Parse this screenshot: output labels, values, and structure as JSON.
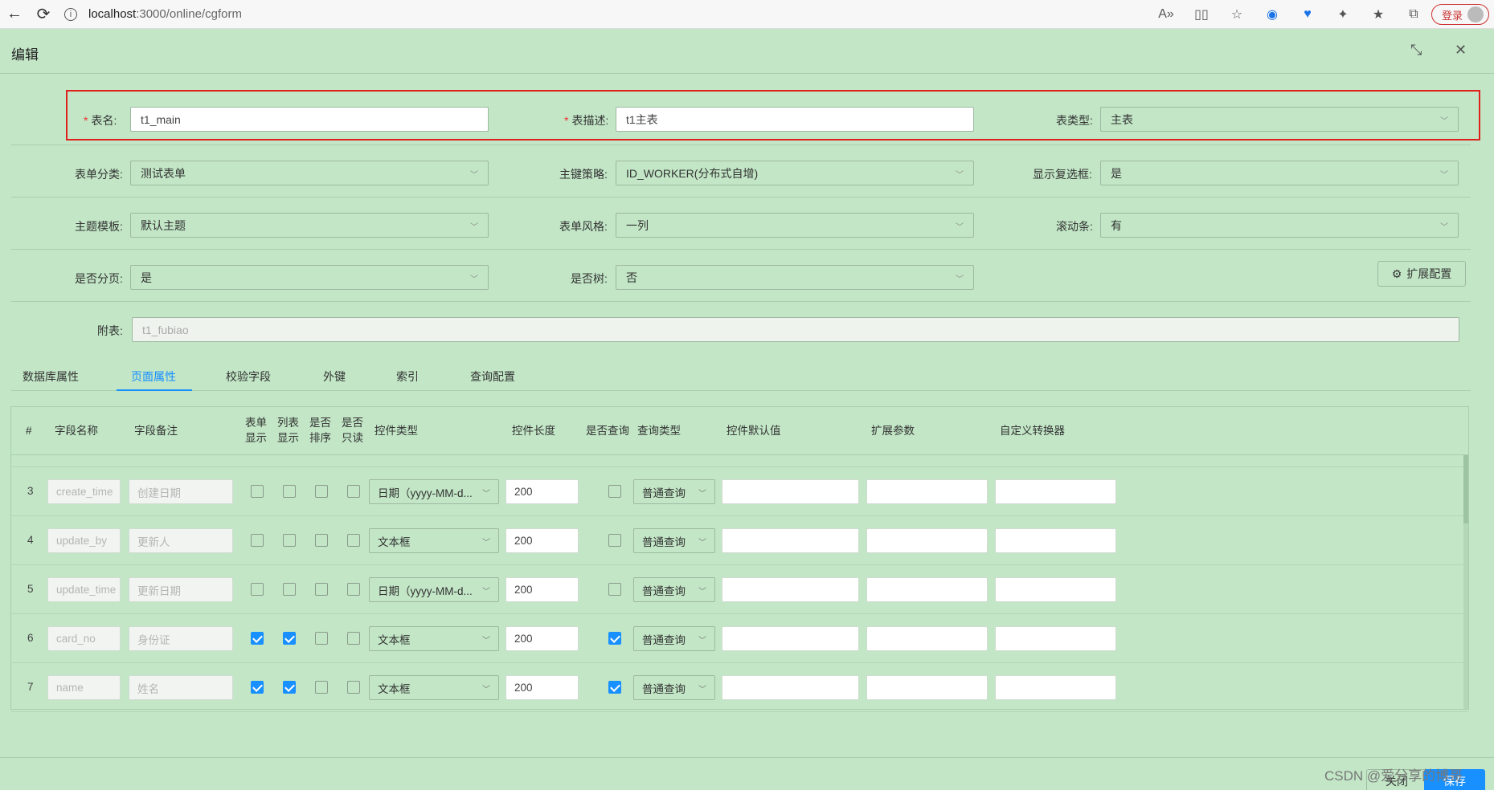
{
  "browser": {
    "url_host": "localhost",
    "url_rest": ":3000/online/cgform",
    "login_label": "登录"
  },
  "modal": {
    "title": "编辑"
  },
  "form": {
    "table_name": {
      "label": "表名:",
      "value": "t1_main"
    },
    "table_desc": {
      "label": "表描述:",
      "value": "t1主表"
    },
    "table_type": {
      "label": "表类型:",
      "value": "主表"
    },
    "form_category": {
      "label": "表单分类:",
      "value": "测试表单"
    },
    "pk_strategy": {
      "label": "主键策略:",
      "value": "ID_WORKER(分布式自增)"
    },
    "show_checkbox": {
      "label": "显示复选框:",
      "value": "是"
    },
    "theme": {
      "label": "主题模板:",
      "value": "默认主题"
    },
    "form_style": {
      "label": "表单风格:",
      "value": "一列"
    },
    "scrollbar": {
      "label": "滚动条:",
      "value": "有"
    },
    "paging": {
      "label": "是否分页:",
      "value": "是"
    },
    "is_tree": {
      "label": "是否树:",
      "value": "否"
    },
    "ext_config_label": "扩展配置",
    "sub_table": {
      "label": "附表:",
      "value": "t1_fubiao"
    }
  },
  "tabs": [
    "数据库属性",
    "页面属性",
    "校验字段",
    "外键",
    "索引",
    "查询配置"
  ],
  "active_tab": "页面属性",
  "table": {
    "headers": {
      "num": "#",
      "field_name": "字段名称",
      "field_remark": "字段备注",
      "form_show_1": "表单",
      "form_show_2": "显示",
      "list_show_1": "列表",
      "list_show_2": "显示",
      "sort_1": "是否",
      "sort_2": "排序",
      "readonly_1": "是否",
      "readonly_2": "只读",
      "ctrl_type": "控件类型",
      "ctrl_len": "控件长度",
      "is_query": "是否查询",
      "query_type": "查询类型",
      "default_val": "控件默认值",
      "ext_param": "扩展参数",
      "converter": "自定义转换器"
    },
    "rows": [
      {
        "num": "3",
        "name": "create_time",
        "remark": "创建日期",
        "form": false,
        "list": false,
        "sort": false,
        "ro": false,
        "ctrl": "日期（yyyy-MM-d...",
        "len": "200",
        "query": false,
        "qtype": "普通查询"
      },
      {
        "num": "4",
        "name": "update_by",
        "remark": "更新人",
        "form": false,
        "list": false,
        "sort": false,
        "ro": false,
        "ctrl": "文本框",
        "len": "200",
        "query": false,
        "qtype": "普通查询"
      },
      {
        "num": "5",
        "name": "update_time",
        "remark": "更新日期",
        "form": false,
        "list": false,
        "sort": false,
        "ro": false,
        "ctrl": "日期（yyyy-MM-d...",
        "len": "200",
        "query": false,
        "qtype": "普通查询"
      },
      {
        "num": "6",
        "name": "card_no",
        "remark": "身份证",
        "form": true,
        "list": true,
        "sort": false,
        "ro": false,
        "ctrl": "文本框",
        "len": "200",
        "query": true,
        "qtype": "普通查询"
      },
      {
        "num": "7",
        "name": "name",
        "remark": "姓名",
        "form": true,
        "list": true,
        "sort": false,
        "ro": false,
        "ctrl": "文本框",
        "len": "200",
        "query": true,
        "qtype": "普通查询"
      }
    ]
  },
  "footer": {
    "cancel_label": "关闭",
    "save_label": "保存",
    "watermark": "CSDN @爱分享的博哥"
  },
  "colors": {
    "background": "#c2e6c6",
    "accent": "#1890ff",
    "required": "#e33333",
    "highlight_border": "#e0201c"
  }
}
